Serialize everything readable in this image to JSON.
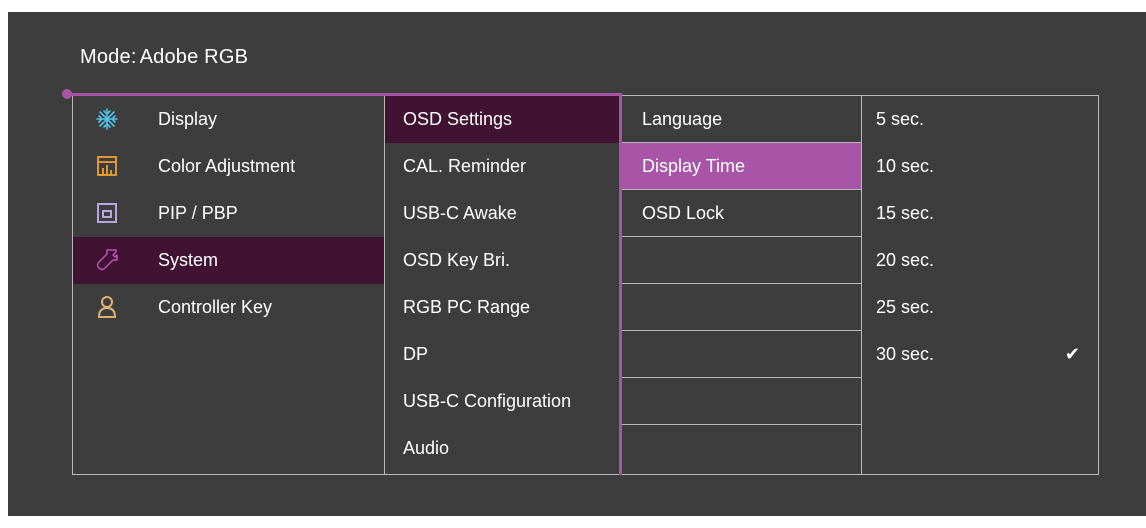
{
  "mode": {
    "label": "Mode:",
    "value": "Adobe RGB"
  },
  "menu": [
    {
      "label": "Display",
      "icon": "display-icon"
    },
    {
      "label": "Color Adjustment",
      "icon": "color-adjustment-icon"
    },
    {
      "label": "PIP / PBP",
      "icon": "pip-pbp-icon"
    },
    {
      "label": "System",
      "icon": "wrench-icon",
      "selected": true
    },
    {
      "label": "Controller Key",
      "icon": "user-icon"
    }
  ],
  "system_items": [
    {
      "label": "OSD Settings",
      "selected": true
    },
    {
      "label": "CAL. Reminder"
    },
    {
      "label": "USB-C Awake"
    },
    {
      "label": "OSD Key Bri."
    },
    {
      "label": "RGB PC Range"
    },
    {
      "label": "DP"
    },
    {
      "label": "USB-C Configuration"
    },
    {
      "label": "Audio"
    }
  ],
  "osd_items": [
    {
      "label": "Language"
    },
    {
      "label": "Display Time",
      "active": true
    },
    {
      "label": "OSD Lock"
    },
    {
      "label": ""
    },
    {
      "label": ""
    },
    {
      "label": ""
    },
    {
      "label": ""
    },
    {
      "label": ""
    }
  ],
  "display_time_options": [
    {
      "label": "5 sec."
    },
    {
      "label": "10 sec."
    },
    {
      "label": "15 sec."
    },
    {
      "label": "20 sec."
    },
    {
      "label": "25 sec."
    },
    {
      "label": "30 sec.",
      "checked": true
    }
  ],
  "check_glyph": "✔",
  "colors": {
    "background": "#3d3d3d",
    "accent": "#a855a8",
    "selected_row": "#3f1331",
    "icon_blue": "#4fc3e8",
    "icon_orange": "#f0a030",
    "icon_lavender": "#b9a6e0",
    "icon_magenta": "#c24fc2",
    "icon_tan": "#e0b070"
  }
}
